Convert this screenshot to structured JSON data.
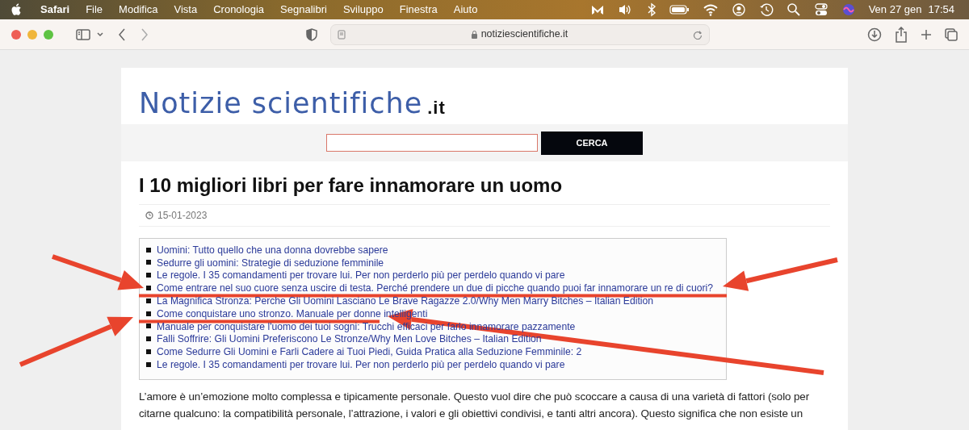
{
  "menubar": {
    "app": "Safari",
    "items": [
      "File",
      "Modifica",
      "Vista",
      "Cronologia",
      "Segnalibri",
      "Sviluppo",
      "Finestra",
      "Aiuto"
    ],
    "date": "Ven 27 gen",
    "time": "17:54"
  },
  "browser": {
    "address": "notiziescientifiche.it"
  },
  "site": {
    "logo": "Notizie scientifiche",
    "logo_suffix": ".it",
    "search_button": "CERCA"
  },
  "article": {
    "title": "I 10 migliori libri per fare innamorare un uomo",
    "date": "15-01-2023",
    "links": [
      "Uomini: Tutto quello che una donna dovrebbe sapere",
      "Sedurre gli uomini: Strategie di seduzione femminile",
      "Le regole. I 35 comandamenti per trovare lui. Per non perderlo più per perdelo quando vi pare",
      "Come entrare nel suo cuore senza uscire di testa. Perché prendere un due di picche quando puoi far innamorare un re di cuori?",
      "La Magnifica Stronza: Perche Gli Uomini Lasciano Le Brave Ragazze 2.0/Why Men Marry Bitches – Italian Edition",
      "Come conquistare uno stronzo. Manuale per donne intelligenti",
      "Manuale per conquistare l'uomo dei tuoi sogni: Trucchi efficaci per farlo innamorare pazzamente",
      "Falli Soffrire: Gli Uomini Preferiscono Le Stronze/Why Men Love Bitches – Italian Edition",
      "Come Sedurre Gli Uomini e Farli Cadere ai Tuoi Piedi, Guida Pratica alla Seduzione Femminile: 2",
      "Le regole. I 35 comandamenti per trovare lui. Per non perderlo più per perdelo quando vi pare"
    ],
    "paragraph": "L’amore è un’emozione molto complessa e tipicamente personale. Questo vuol dire che può scoccare a causa di una varietà di fattori (solo per citarne qualcuno: la compatibilità personale, l’attrazione, i valori e gli obiettivi condivisi, e tanti altri ancora). Questo significa che non esiste un"
  }
}
